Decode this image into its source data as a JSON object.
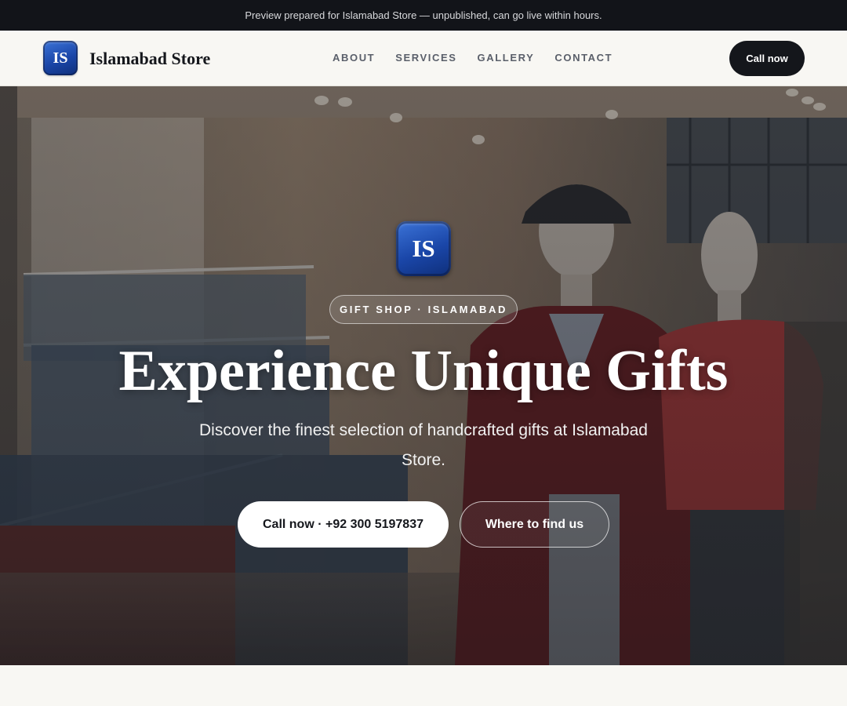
{
  "preview_bar": {
    "text": "Preview prepared for Islamabad Store — unpublished, can go live within hours."
  },
  "header": {
    "logo_initials": "IS",
    "brand_name": "Islamabad Store",
    "nav": [
      "ABOUT",
      "SERVICES",
      "GALLERY",
      "CONTACT"
    ],
    "cta_label": "Call now"
  },
  "hero": {
    "badge_initials": "IS",
    "eyebrow": "GIFT SHOP · ISLAMABAD",
    "title": "Experience Unique Gifts",
    "subtitle": "Discover the finest selection of handcrafted gifts at Islamabad Store.",
    "primary_button": "Call now · +92 300 5197837",
    "secondary_button": "Where to find us",
    "background": "clothing-store-interior-with-mannequins"
  },
  "colors": {
    "badge_blue": "#1a46a8",
    "dark": "#14161b",
    "page_bg": "#f8f7f3"
  }
}
